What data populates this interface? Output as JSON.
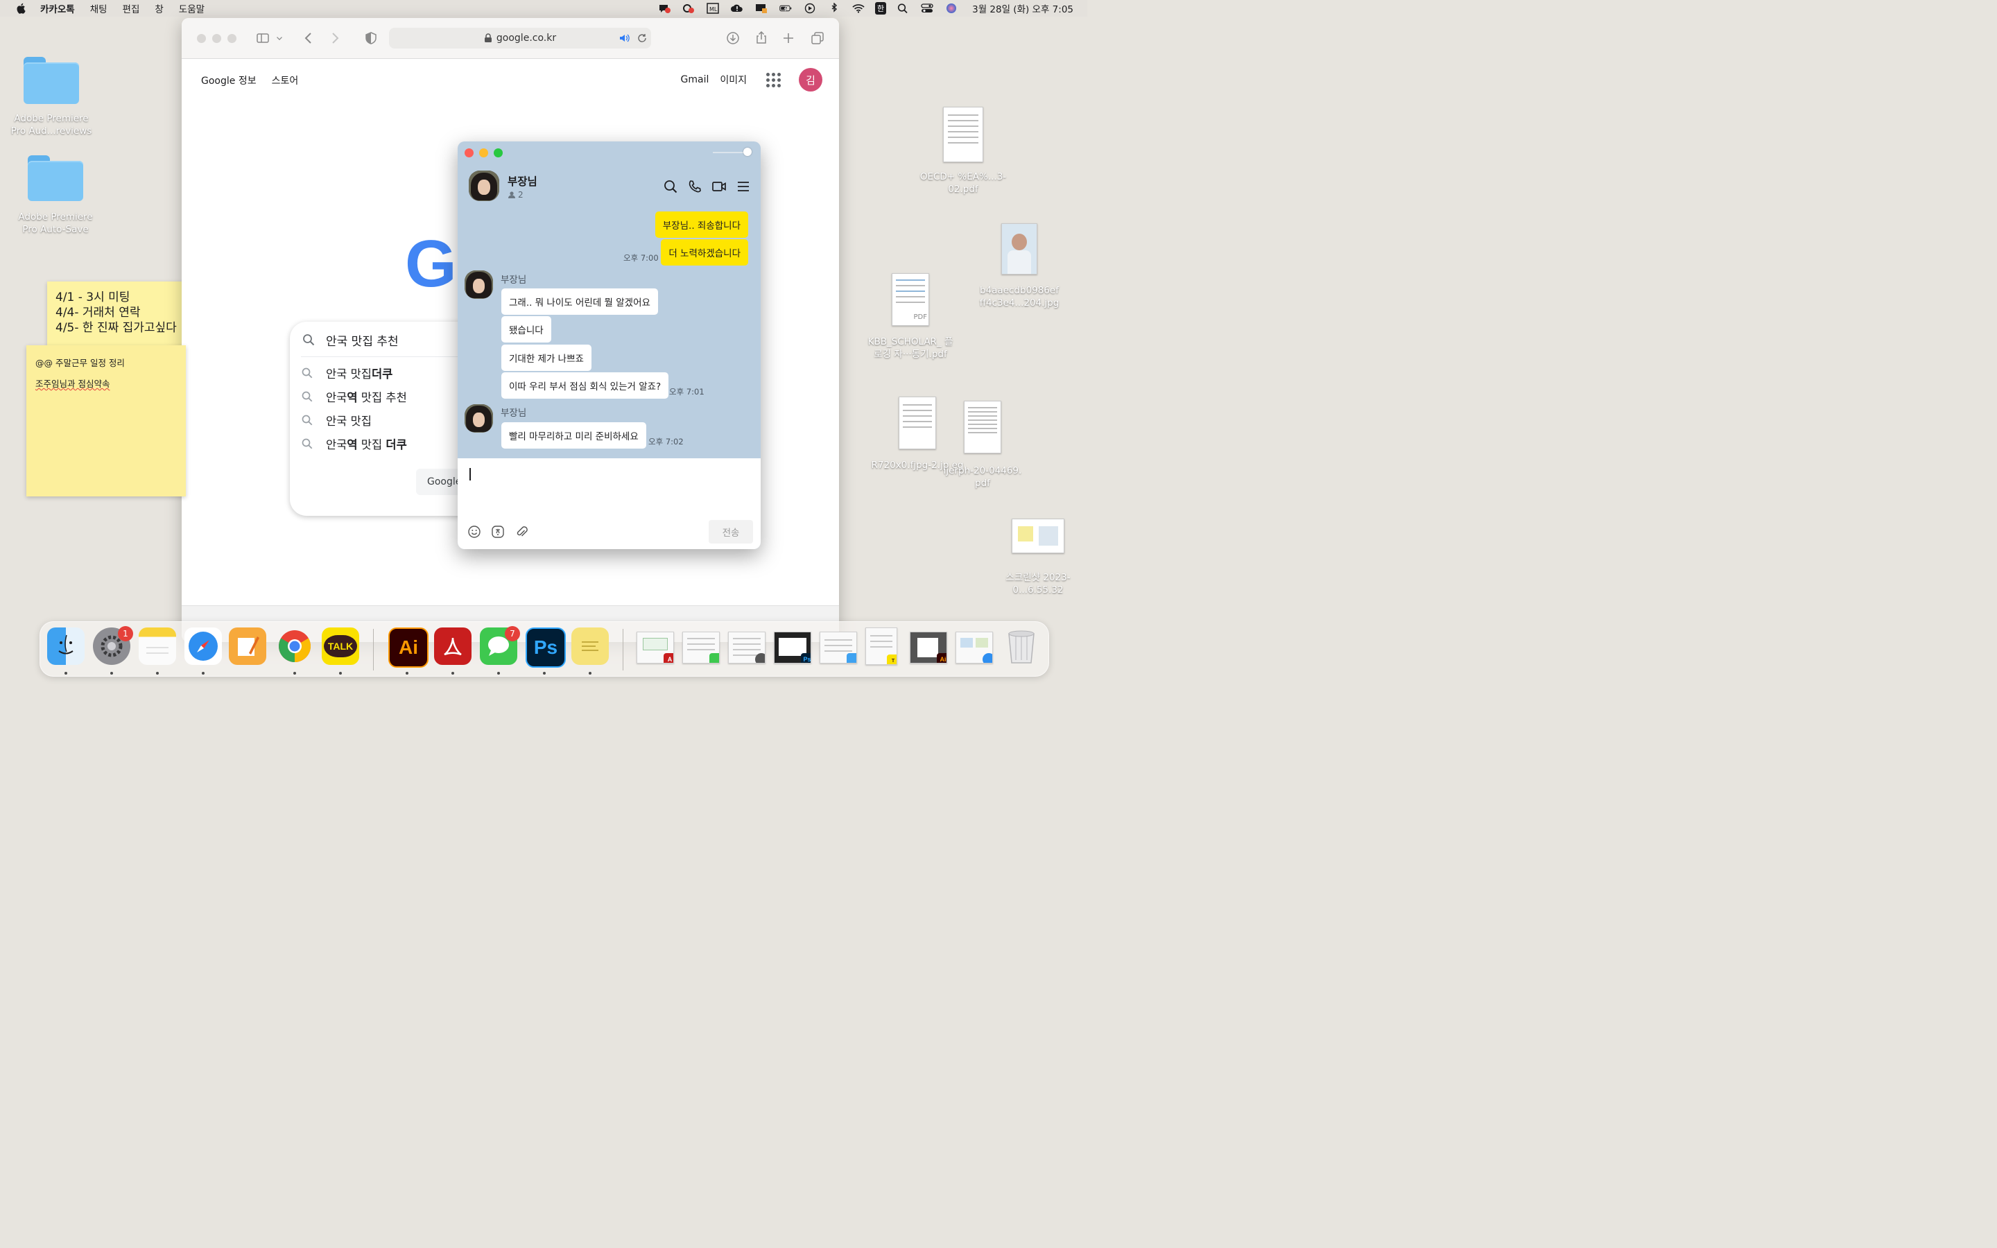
{
  "menubar": {
    "app_name": "카카오톡",
    "items": [
      "채팅",
      "편집",
      "창",
      "도움말"
    ],
    "input_method": "한",
    "clock": "3월 28일 (화) 오후 7:05"
  },
  "desktop_left": [
    {
      "name": "Adobe Premiere Pro Aud...reviews"
    },
    {
      "name": "Adobe Premiere Pro Auto-Save"
    }
  ],
  "desktop_right": [
    {
      "name": "OECD+ %EA%...3-02.pdf"
    },
    {
      "name": "b4aaecdb0986ef ff4c3e4...204.jpg"
    },
    {
      "name": "KBB_SCHOLAR_ 플로깅 자···동기.pdf",
      "badge": "PDF"
    },
    {
      "name": "R720x0.fjpg-2.jp eg"
    },
    {
      "name": "ijerph-20-04469. pdf"
    },
    {
      "name": "스크린샷 2023-0...6.55.32"
    }
  ],
  "sticky1": {
    "lines": [
      "4/1 - 3시 미팅",
      "4/4- 거래처 연락",
      "4/5- 한 진짜 집가고싶다"
    ]
  },
  "sticky2": {
    "lines": [
      "@@ 주말근무 일정 정리",
      "조주임님과 점심약속"
    ]
  },
  "safari": {
    "url": "google.co.kr",
    "links_left": [
      "Google 정보",
      "스토어"
    ],
    "links_right": [
      "Gmail",
      "이미지"
    ],
    "account_initial": "김",
    "logo_letter": "G",
    "search_query": "안국 맛집 추천",
    "suggestions": [
      {
        "plain": "안국 맛집 ",
        "bold": "더쿠"
      },
      {
        "plain": "안국",
        "bold": "역",
        "rest": " 맛집 추천"
      },
      {
        "plain": "안국 맛집",
        "bold": ""
      },
      {
        "plain": "안국",
        "bold": "역",
        "rest": " 맛집 ",
        "bold2": "더쿠"
      }
    ],
    "search_button": "Google"
  },
  "chat": {
    "room_name": "부장님",
    "member_count": "2",
    "messages_me": [
      {
        "text": "부장님.. 죄송합니다"
      },
      {
        "text": "더 노력하겠습니다",
        "time": "오후 7:00"
      }
    ],
    "group1": {
      "sender": "부장님",
      "messages": [
        "그래.. 뭐 나이도 어린데 뭘 알겠어요",
        "됐습니다",
        "기대한 제가 나쁘죠",
        "이따 우리 부서 점심 회식 있는거 알죠?"
      ],
      "time": "오후 7:01"
    },
    "group2": {
      "sender": "부장님",
      "messages": [
        "빨리 마무리하고 미리 준비하세요"
      ],
      "time": "오후 7:02"
    },
    "send_label": "전송"
  },
  "dock": {
    "apps": [
      {
        "name": "finder"
      },
      {
        "name": "system-settings",
        "badge": "1"
      },
      {
        "name": "notes"
      },
      {
        "name": "safari"
      },
      {
        "name": "pages"
      },
      {
        "name": "chrome"
      },
      {
        "name": "kakaotalk",
        "label": "TALK"
      },
      {
        "name": "illustrator",
        "label": "Ai"
      },
      {
        "name": "acrobat"
      },
      {
        "name": "messages",
        "badge": "7"
      },
      {
        "name": "photoshop",
        "label": "Ps"
      },
      {
        "name": "stickies"
      }
    ]
  }
}
